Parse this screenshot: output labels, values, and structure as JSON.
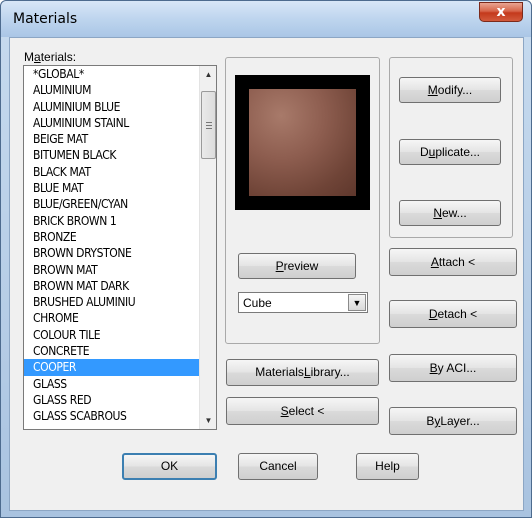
{
  "window": {
    "title": "Materials",
    "close_glyph": "x"
  },
  "materials_label_prefix": "M",
  "materials_label_accel": "a",
  "materials_label_suffix": "terials:",
  "materials": [
    "*GLOBAL*",
    "ALUMINIUM",
    "ALUMINIUM BLUE",
    "ALUMINIUM STAINL",
    "BEIGE MAT",
    "BITUMEN BLACK",
    "BLACK MAT",
    "BLUE MAT",
    "BLUE/GREEN/CYAN",
    "BRICK BROWN 1",
    "BRONZE",
    "BROWN DRYSTONE",
    "BROWN MAT",
    "BROWN MAT DARK",
    "BRUSHED ALUMINIU",
    "CHROME",
    "COLOUR TILE",
    "CONCRETE",
    "COOPER",
    "GLASS",
    "GLASS RED",
    "GLASS SCABROUS"
  ],
  "selected_material": "COOPER",
  "preview": {
    "button": {
      "pre": "",
      "accel": "P",
      "post": "review"
    },
    "shape_value": "Cube",
    "swatch_color": "#8d5d4f"
  },
  "buttons": {
    "modify": {
      "pre": "",
      "accel": "M",
      "post": "odify..."
    },
    "duplicate": {
      "pre": "D",
      "accel": "u",
      "post": "plicate..."
    },
    "new": {
      "pre": "",
      "accel": "N",
      "post": "ew..."
    },
    "attach": {
      "pre": "",
      "accel": "A",
      "post": "ttach <"
    },
    "detach": {
      "pre": "",
      "accel": "D",
      "post": "etach <"
    },
    "by_aci": {
      "pre": "",
      "accel": "B",
      "post": "y ACI..."
    },
    "by_layer": {
      "pre": "B",
      "accel": "y",
      "post": " Layer..."
    },
    "materials_library": {
      "pre": "Materials ",
      "accel": "L",
      "post": "ibrary..."
    },
    "select": {
      "pre": "",
      "accel": "S",
      "post": "elect <"
    },
    "ok": "OK",
    "cancel": "Cancel",
    "help": "Help"
  },
  "scrollbar": {
    "up_glyph": "▲",
    "down_glyph": "▼",
    "grip_glyph": "≡"
  },
  "combo_arrow_glyph": "▼"
}
